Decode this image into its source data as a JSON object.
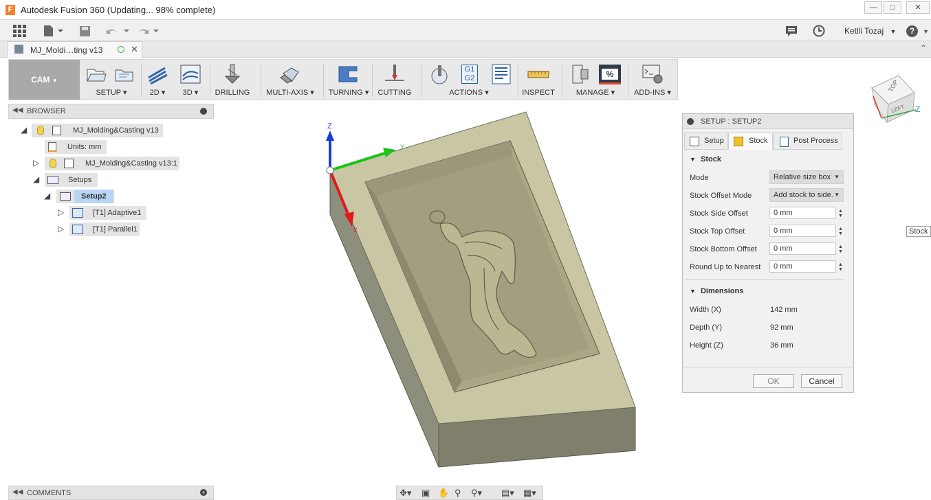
{
  "window": {
    "title": "Autodesk Fusion 360  (Updating... 98% complete)",
    "app_icon_letter": "F",
    "minimize": "—",
    "maximize": "□",
    "close": "✕"
  },
  "quick_access": {
    "user": "Ketlli Tozaj",
    "help": "?"
  },
  "document_tab": {
    "label": "MJ_Moldi…ting v13",
    "close": "✕"
  },
  "ribbon": {
    "workspace": "CAM",
    "groups": {
      "setup": "SETUP",
      "g2d": "2D",
      "g3d": "3D",
      "drilling": "DRILLING",
      "multiaxis": "MULTI-AXIS",
      "turning": "TURNING",
      "cutting": "CUTTING",
      "actions": "ACTIONS",
      "inspect": "INSPECT",
      "manage": "MANAGE",
      "addins": "ADD-INS"
    },
    "g1g2_top": "G1",
    "g1g2_bottom": "G2",
    "percent": "%"
  },
  "browser": {
    "title": "BROWSER",
    "items": {
      "root": "MJ_Molding&Casting v13",
      "units": "Units: mm",
      "component": "MJ_Molding&Casting v13:1",
      "setups": "Setups",
      "setup2": "Setup2",
      "adaptive": "[T1] Adaptive1",
      "parallel": "[T1] Parallel1"
    }
  },
  "comments": {
    "title": "COMMENTS"
  },
  "axes": {
    "z": "Z",
    "y": "Y",
    "x": "X"
  },
  "viewcube": {
    "top": "TOP",
    "left": "LEFT",
    "z": "Z"
  },
  "dialog": {
    "title": "SETUP : SETUP2",
    "tabs": {
      "setup": "Setup",
      "stock": "Stock",
      "post": "Post Process"
    },
    "stock_section": "Stock",
    "mode_label": "Mode",
    "mode_value": "Relative size box",
    "offset_mode_label": "Stock Offset Mode",
    "offset_mode_value": "Add stock to side...",
    "side_offset_label": "Stock Side Offset",
    "side_offset_value": "0 mm",
    "top_offset_label": "Stock Top Offset",
    "top_offset_value": "0 mm",
    "bottom_offset_label": "Stock Bottom Offset",
    "bottom_offset_value": "0 mm",
    "round_label": "Round Up to Nearest",
    "round_value": "0 mm",
    "dimensions_section": "Dimensions",
    "width_label": "Width (X)",
    "width_value": "142 mm",
    "depth_label": "Depth (Y)",
    "depth_value": "92 mm",
    "height_label": "Height (Z)",
    "height_value": "36 mm",
    "ok": "OK",
    "cancel": "Cancel"
  },
  "tooltip": "Stock S"
}
